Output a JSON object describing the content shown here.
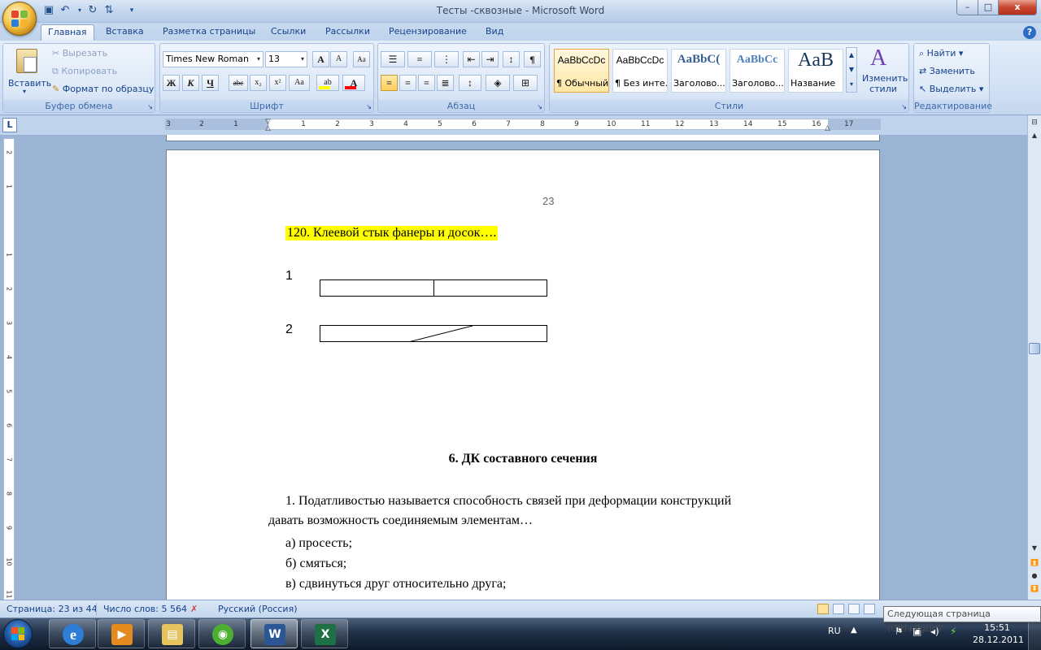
{
  "window": {
    "title": "Тесты -сквозные - Microsoft Word",
    "minimize": "–",
    "maximize": "□",
    "close": "x"
  },
  "qat": [
    "save-icon",
    "undo-icon",
    "redo-icon",
    "customize-icon"
  ],
  "tabs": [
    {
      "label": "Главная",
      "active": true
    },
    {
      "label": "Вставка"
    },
    {
      "label": "Разметка страницы"
    },
    {
      "label": "Ссылки"
    },
    {
      "label": "Рассылки"
    },
    {
      "label": "Рецензирование"
    },
    {
      "label": "Вид"
    }
  ],
  "clipboard": {
    "group_label": "Буфер обмена",
    "paste_label": "Вставить",
    "cut_label": "Вырезать",
    "copy_label": "Копировать",
    "format_painter_label": "Формат по образцу"
  },
  "font": {
    "group_label": "Шрифт",
    "font_name": "Times New Roman",
    "font_size": "13",
    "bold": "Ж",
    "italic": "К",
    "underline": "Ч",
    "strike": "abc",
    "subscript": "x₂",
    "superscript": "x²",
    "change_case": "Aa",
    "grow": "A",
    "shrink": "A",
    "highlight_color": "#ffff00",
    "font_color": "#ff0000"
  },
  "paragraph": {
    "group_label": "Абзац"
  },
  "styles": {
    "group_label": "Стили",
    "items": [
      {
        "preview": "AaBbCcDc",
        "name": "¶ Обычный",
        "selected": true
      },
      {
        "preview": "AaBbCcDc",
        "name": "¶ Без инте..."
      },
      {
        "preview": "AaBbC(",
        "name": "Заголово..."
      },
      {
        "preview": "AaBbCc",
        "name": "Заголово..."
      },
      {
        "preview": "AaB",
        "name": "Название"
      }
    ],
    "change_styles_label": "Изменить стили"
  },
  "editing": {
    "group_label": "Редактирование",
    "find_label": "Найти",
    "replace_label": "Заменить",
    "select_label": "Выделить"
  },
  "ruler": {
    "tab_selector": "L",
    "numbers": [
      "3",
      "2",
      "1",
      "1",
      "2",
      "3",
      "4",
      "5",
      "6",
      "7",
      "8",
      "9",
      "10",
      "11",
      "12",
      "13",
      "14",
      "15",
      "16",
      "17"
    ],
    "vnumbers": [
      "2",
      "1",
      "1",
      "2",
      "3",
      "4",
      "5",
      "6",
      "7",
      "8",
      "9",
      "10",
      "11"
    ]
  },
  "document": {
    "page_number": "23",
    "question_120": "120. Клеевой стык фанеры и досок….",
    "figure_1_label": "1",
    "figure_2_label": "2",
    "section_title": "6. ДК составного сечения",
    "q1_line1": "1. Податливостью называется способность связей при деформации конструкций",
    "q1_line2": "давать возможность соединяемым элементам…",
    "option_a": "а) просесть;",
    "option_b": "б) смяться;",
    "option_c": "в) сдвинуться друг относительно друга;"
  },
  "statusbar": {
    "page": "Страница: 23 из 44",
    "words": "Число слов: 5 564",
    "language": "Русский (Россия)",
    "tooltip": "Следующая страница (Ctrl+PgDn)"
  },
  "taskbar": {
    "apps": [
      "internet-explorer-icon",
      "media-player-icon",
      "explorer-icon",
      "network-app-icon",
      "word-icon",
      "excel-icon"
    ],
    "active_app": "word-icon",
    "language": "RU",
    "time": "15:51",
    "date": "28.12.2011"
  }
}
